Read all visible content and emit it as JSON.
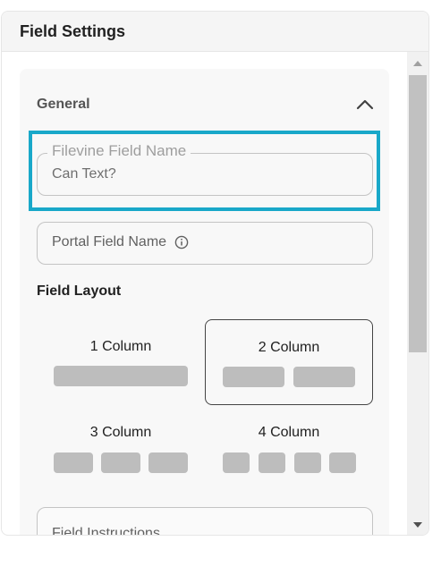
{
  "panel": {
    "title": "Field Settings"
  },
  "general": {
    "title": "General",
    "filevine_field": {
      "label": "Filevine Field Name",
      "value": "Can Text?"
    },
    "portal_field": {
      "placeholder": "Portal Field Name"
    },
    "layout": {
      "title": "Field Layout",
      "options": [
        {
          "label": "1 Column",
          "columns": 1,
          "selected": false
        },
        {
          "label": "2 Column",
          "columns": 2,
          "selected": true
        },
        {
          "label": "3 Column",
          "columns": 3,
          "selected": false
        },
        {
          "label": "4 Column",
          "columns": 4,
          "selected": false
        }
      ]
    },
    "instructions": {
      "placeholder": "Field Instructions"
    }
  },
  "colors": {
    "highlight": "#19a8c9",
    "bar": "#bdbdbd"
  },
  "icons": {
    "collapse": "chevron-up-icon",
    "info": "info-icon",
    "scroll_up": "arrow-up-icon",
    "scroll_down": "arrow-down-icon"
  }
}
